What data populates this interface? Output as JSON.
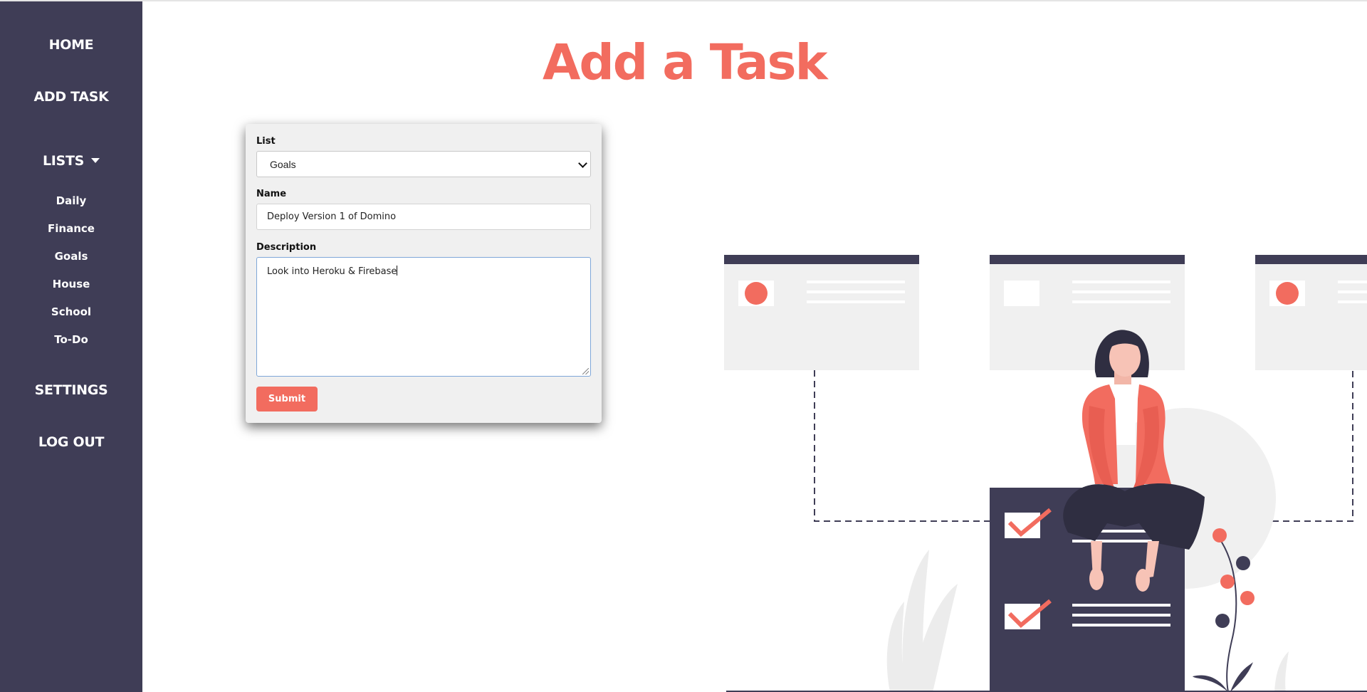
{
  "sidebar": {
    "home": "HOME",
    "add_task": "ADD TASK",
    "lists": "LISTS",
    "list_items": [
      "Daily",
      "Finance",
      "Goals",
      "House",
      "School",
      "To-Do"
    ],
    "settings": "SETTINGS",
    "log_out": "LOG OUT"
  },
  "main": {
    "title": "Add a Task"
  },
  "form": {
    "list_label": "List",
    "list_value": "Goals",
    "name_label": "Name",
    "name_value": "Deploy Version 1 of Domino",
    "description_label": "Description",
    "description_value": "Look into Heroku & Firebase",
    "submit_label": "Submit"
  },
  "colors": {
    "sidebar_bg": "#3f3d56",
    "accent": "#f26c5f",
    "card_bg": "#f0f0f0"
  },
  "illustration": {
    "icon": "woman-sitting-on-task-board-illustration"
  }
}
